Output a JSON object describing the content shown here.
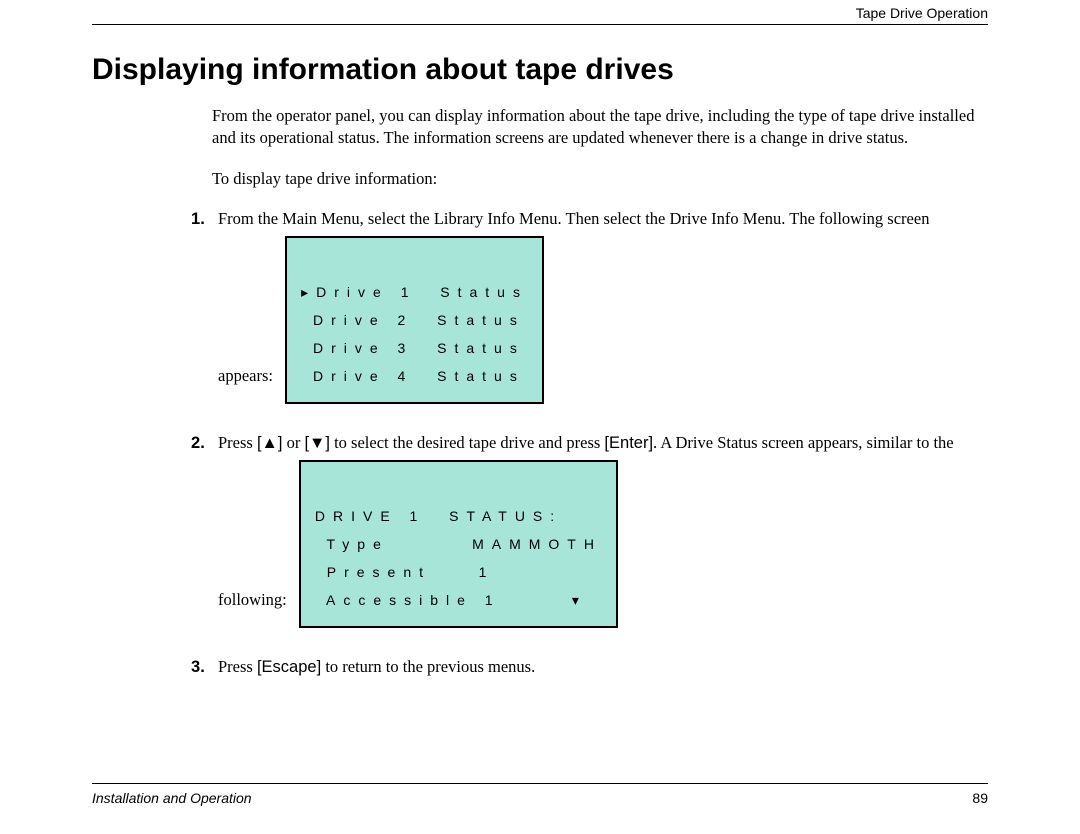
{
  "header": {
    "running_head": "Tape Drive Operation"
  },
  "title": "Displaying information about tape drives",
  "intro": {
    "p1": "From the operator panel, you can display information about the tape drive, including the type of tape drive installed and its operational status. The information screens are updated whenever there is a change in drive status.",
    "p2": "To display tape drive information:"
  },
  "steps": {
    "s1": "From the Main Menu, select the Library Info Menu. Then select the Drive Info Menu. The following screen appears:",
    "s2a": "Press ",
    "s2b": " or ",
    "s2c": " to select the desired tape drive and press ",
    "s2d": ". A Drive Status screen appears, similar to the following:",
    "s3a": "Press ",
    "s3b": " to return to the previous menus."
  },
  "keys": {
    "up": "[▲]",
    "down": "[▼]",
    "enter": "[Enter]",
    "escape": "[Escape]"
  },
  "screen1": {
    "r1": "▸Drive 1  Status",
    "r2": " Drive 2  Status",
    "r3": " Drive 3  Status",
    "r4": " Drive 4  Status"
  },
  "screen2": {
    "r1": "DRIVE 1  STATUS:",
    "r2": " Type       MAMMOTH",
    "r3": " Present    1",
    "r4": " Accessible 1      ▾"
  },
  "footer": {
    "left": "Installation and Operation",
    "page": "89"
  }
}
